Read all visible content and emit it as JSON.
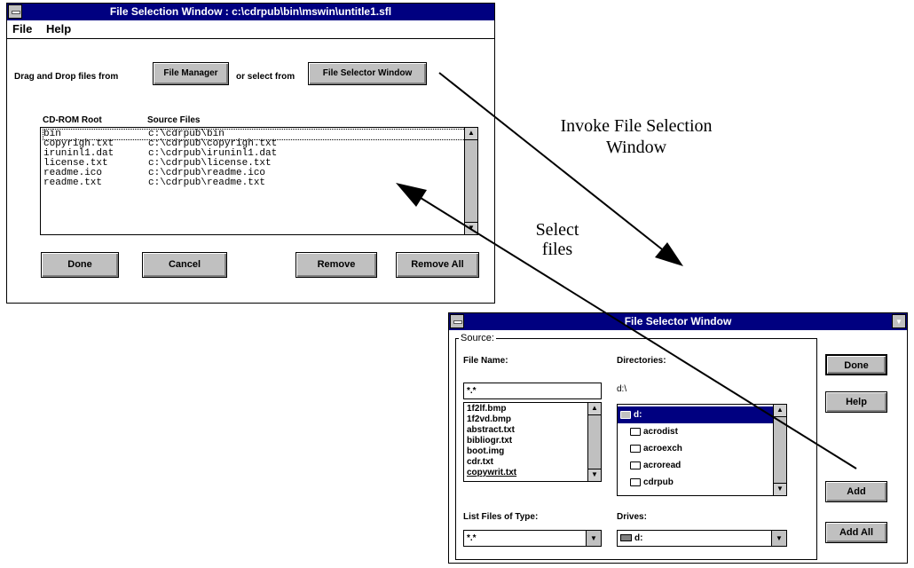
{
  "main_window": {
    "title": "File Selection Window : c:\\cdrpub\\bin\\mswin\\untitle1.sfl",
    "menu": [
      "File",
      "Help"
    ],
    "drag_text": "Drag and Drop files from",
    "file_manager_button": "File Manager",
    "or_text": "or select from",
    "file_selector_button": "File Selector Window",
    "col_root": "CD-ROM Root",
    "col_source": "Source Files",
    "rows": [
      {
        "root": "bin",
        "source": "c:\\cdrpub\\bin"
      },
      {
        "root": "copyrigh.txt",
        "source": "c:\\cdrpub\\copyrigh.txt"
      },
      {
        "root": "iruninl1.dat",
        "source": "c:\\cdrpub\\iruninl1.dat"
      },
      {
        "root": "license.txt",
        "source": "c:\\cdrpub\\license.txt"
      },
      {
        "root": "readme.ico",
        "source": "c:\\cdrpub\\readme.ico"
      },
      {
        "root": "readme.txt",
        "source": "c:\\cdrpub\\readme.txt"
      }
    ],
    "buttons": {
      "done": "Done",
      "cancel": "Cancel",
      "remove": "Remove",
      "remove_all": "Remove All"
    }
  },
  "selector_window": {
    "title": "File Selector Window",
    "source_label": "Source:",
    "file_name_label": "File Name:",
    "file_name_value": "*.*",
    "files": [
      "1f2lf.bmp",
      "1f2vd.bmp",
      "abstract.txt",
      "bibliogr.txt",
      "boot.img",
      "cdr.txt",
      "copywrit.txt"
    ],
    "directories_label": "Directories:",
    "current_dir": "d:\\",
    "dirs": [
      "d:",
      "acrodist",
      "acroexch",
      "acroread",
      "cdrpub"
    ],
    "list_type_label": "List Files of Type:",
    "list_type_value": "*.*",
    "drives_label": "Drives:",
    "drive_value": "d:",
    "buttons": {
      "done": "Done",
      "help": "Help",
      "add": "Add",
      "add_all": "Add All"
    }
  },
  "annotations": {
    "invoke_line1": "Invoke File Selection",
    "invoke_line2": "Window",
    "select_line1": "Select",
    "select_line2": "files"
  },
  "colors": {
    "titlebar": "#000080",
    "button_face": "#c0c0c0",
    "selection": "#000080"
  }
}
